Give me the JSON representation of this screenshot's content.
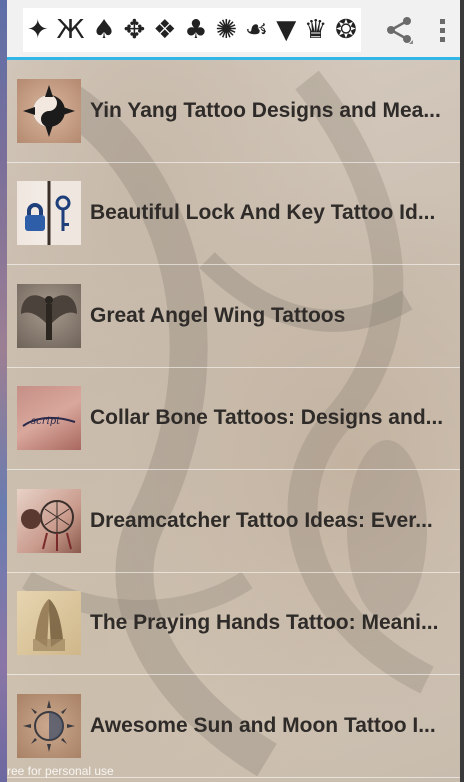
{
  "app_bar": {
    "banner_glyphs": [
      "✦",
      "Ж",
      "♠",
      "✥",
      "❖",
      "♣",
      "✺",
      "☙",
      "▼",
      "♛",
      "❂"
    ]
  },
  "articles": [
    {
      "title": "Yin Yang Tattoo Designs and Mea...",
      "thumb_icon": "yin-yang-tattoo-thumbnail"
    },
    {
      "title": "Beautiful Lock And Key Tattoo Id...",
      "thumb_icon": "lock-and-key-tattoo-thumbnail"
    },
    {
      "title": "Great Angel Wing Tattoos",
      "thumb_icon": "angel-wing-tattoo-thumbnail"
    },
    {
      "title": "Collar Bone Tattoos: Designs and...",
      "thumb_icon": "collar-bone-tattoo-thumbnail"
    },
    {
      "title": "Dreamcatcher Tattoo Ideas: Ever...",
      "thumb_icon": "dreamcatcher-tattoo-thumbnail"
    },
    {
      "title": "The Praying Hands Tattoo: Meani...",
      "thumb_icon": "praying-hands-tattoo-thumbnail"
    },
    {
      "title": "Awesome Sun and Moon Tattoo I...",
      "thumb_icon": "sun-and-moon-tattoo-thumbnail"
    }
  ],
  "footer": {
    "text": "ree for personal use"
  },
  "colors": {
    "accent": "#33b5e5",
    "action_bar": "#f1f1f1",
    "title_text": "#2e2b29"
  }
}
